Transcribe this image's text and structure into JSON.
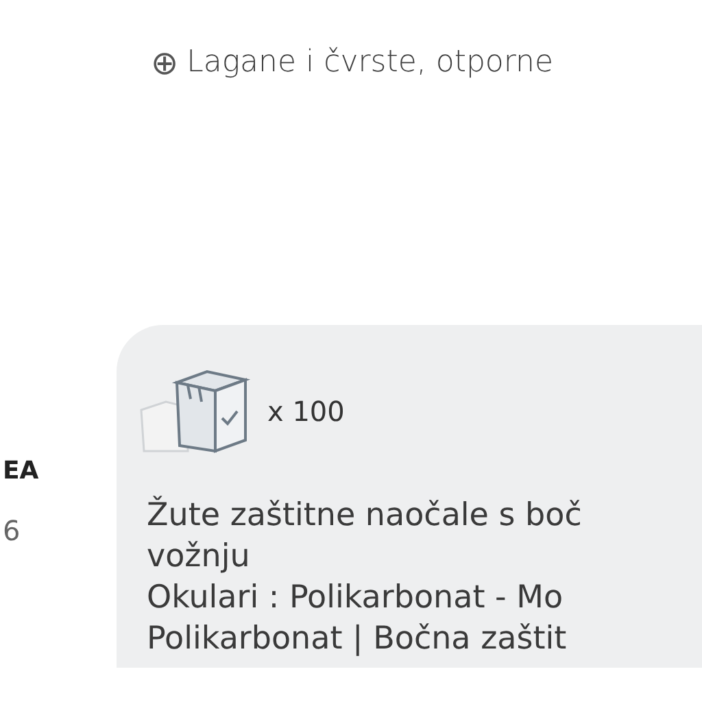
{
  "feature": {
    "icon": "⊕",
    "text": "Lagane i čvrste, otporne"
  },
  "left_column": {
    "title": "EA",
    "value": "6"
  },
  "product_card": {
    "quantity": "x 100",
    "description_lines": [
      "Žute zaštitne naočale s boč",
      "vožnju",
      "Okulari : Polikarbonat - Mo",
      "Polikarbonat | Bočna zaštit"
    ]
  }
}
